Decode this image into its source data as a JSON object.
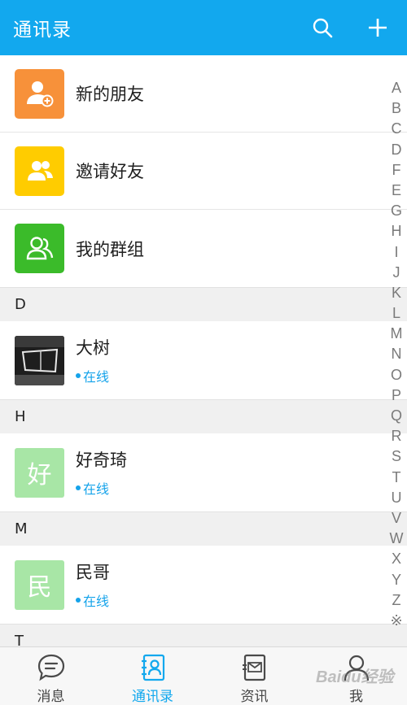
{
  "header": {
    "title": "通讯录",
    "search_icon": "search-icon",
    "add_icon": "plus-icon"
  },
  "fixed_entries": [
    {
      "label": "新的朋友",
      "icon": "add-contact-icon",
      "color": "#f7913a"
    },
    {
      "label": "邀请好友",
      "icon": "invite-friends-icon",
      "color": "#ffcc00"
    },
    {
      "label": "我的群组",
      "icon": "group-icon",
      "color": "#3bbb2a"
    }
  ],
  "sections": [
    {
      "letter": "D",
      "contacts": [
        {
          "name": "大树",
          "status": "在线",
          "avatar_text": ""
        }
      ]
    },
    {
      "letter": "H",
      "contacts": [
        {
          "name": "好奇琦",
          "status": "在线",
          "avatar_text": "好"
        }
      ]
    },
    {
      "letter": "M",
      "contacts": [
        {
          "name": "民哥",
          "status": "在线",
          "avatar_text": "民"
        }
      ]
    },
    {
      "letter": "T",
      "contacts": []
    }
  ],
  "index_letters": [
    "A",
    "B",
    "C",
    "D",
    "F",
    "E",
    "G",
    "H",
    "I",
    "J",
    "K",
    "L",
    "M",
    "N",
    "O",
    "P",
    "Q",
    "R",
    "S",
    "T",
    "U",
    "V",
    "W",
    "X",
    "Y",
    "Z",
    "※"
  ],
  "bottom_nav": [
    {
      "label": "消息",
      "icon": "message-icon",
      "active": false
    },
    {
      "label": "通讯录",
      "icon": "contacts-icon",
      "active": true
    },
    {
      "label": "资讯",
      "icon": "news-icon",
      "active": false
    },
    {
      "label": "我",
      "icon": "profile-icon",
      "active": false
    }
  ],
  "colors": {
    "accent": "#12a8ee",
    "online": "#15a3ea",
    "avatar_green": "#a8e6a6"
  },
  "watermark": "Baidu经验"
}
